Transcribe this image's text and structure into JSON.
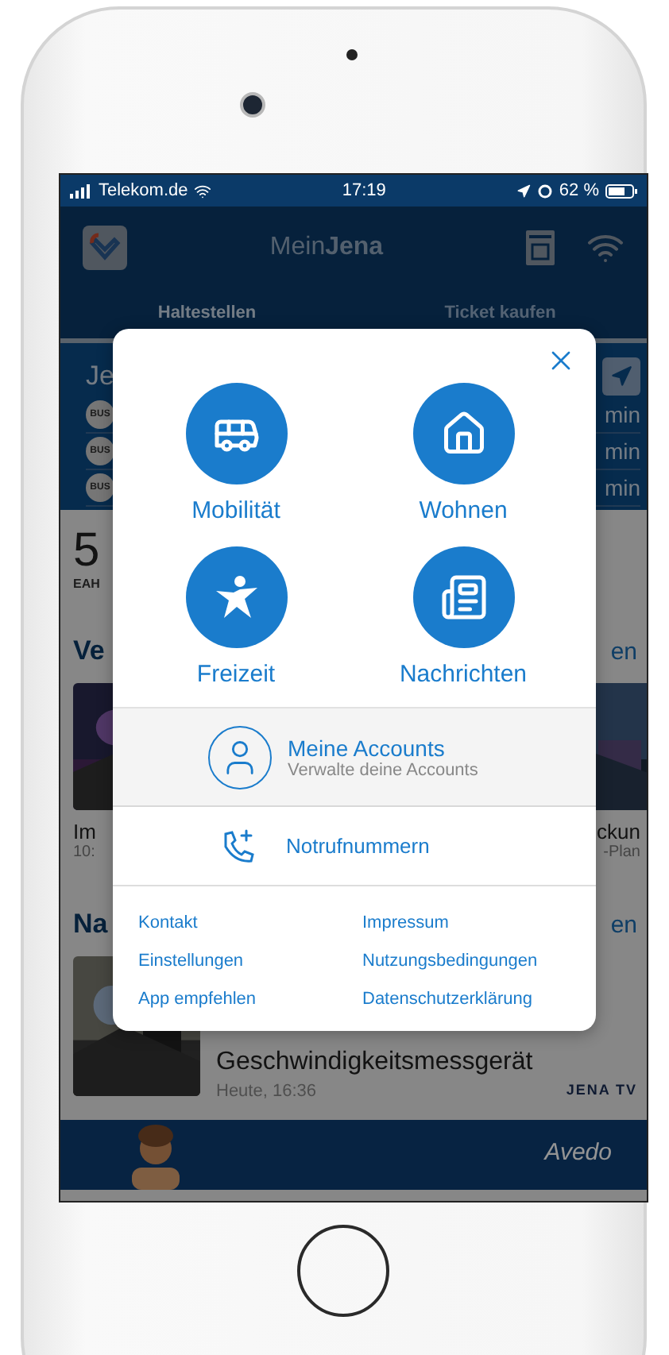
{
  "status_bar": {
    "carrier": "Telekom.de",
    "time": "17:19",
    "battery": "62 %"
  },
  "header": {
    "title_light": "Mein",
    "title_bold": "Jena"
  },
  "tabs": [
    {
      "label": "Haltestellen",
      "selected": true
    },
    {
      "label": "Ticket kaufen",
      "selected": false
    }
  ],
  "stop": {
    "name": "Je",
    "departures": [
      {
        "badge": "BUS",
        "eta": "min"
      },
      {
        "badge": "BUS",
        "eta": "min"
      },
      {
        "badge": "BUS",
        "eta": "min"
      }
    ]
  },
  "behind": {
    "count": "5",
    "count_caption": "EAH",
    "events_heading": "Ve",
    "events_more": "en",
    "event_left": {
      "title": "Im",
      "time": "10:"
    },
    "event_right": {
      "title": "ckun",
      "subtitle": "-Plan"
    },
    "news_heading": "Na",
    "news_more": "en",
    "news": {
      "title": "Geschwindigkeitsmessgerät",
      "time": "Heute, 16:36",
      "source": "JENA TV"
    },
    "ad": {
      "brand": "Avedo"
    }
  },
  "menu": {
    "tiles": [
      {
        "label": "Mobilität",
        "kind": "bus"
      },
      {
        "label": "Wohnen",
        "kind": "house"
      },
      {
        "label": "Freizeit",
        "kind": "star"
      },
      {
        "label": "Nachrichten",
        "kind": "news"
      }
    ],
    "account": {
      "title": "Meine Accounts",
      "subtitle": "Verwalte deine Accounts"
    },
    "emergency": "Notrufnummern",
    "links": [
      "Kontakt",
      "Impressum",
      "Einstellungen",
      "Nutzungsbedingungen",
      "App empfehlen",
      "Datenschutzerklärung"
    ]
  }
}
